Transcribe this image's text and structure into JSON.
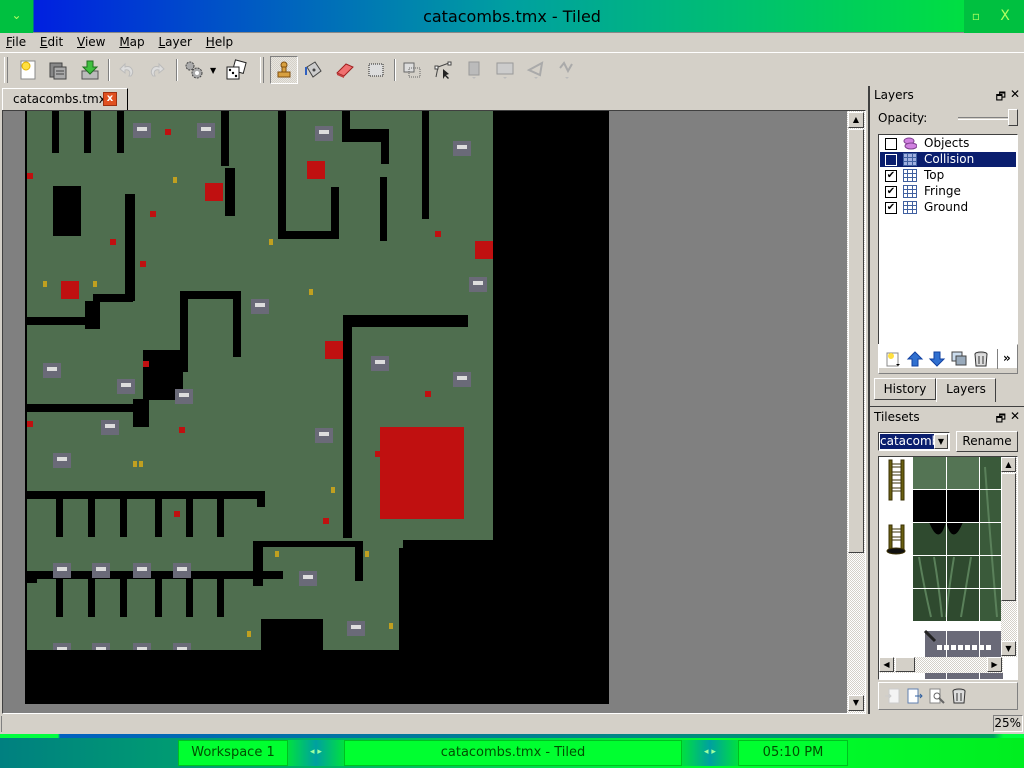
{
  "window": {
    "title": "catacombs.tmx - Tiled",
    "menu_icon": "⌄",
    "maximize_icon": "🗗",
    "close_icon": "X"
  },
  "menubar": {
    "items": [
      {
        "label": "File",
        "mnemonic": "F",
        "rest": "ile"
      },
      {
        "label": "Edit",
        "mnemonic": "E",
        "rest": "dit"
      },
      {
        "label": "View",
        "mnemonic": "V",
        "rest": "iew"
      },
      {
        "label": "Map",
        "mnemonic": "M",
        "rest": "ap"
      },
      {
        "label": "Layer",
        "mnemonic": "L",
        "rest": "ayer"
      },
      {
        "label": "Help",
        "mnemonic": "H",
        "rest": "elp"
      }
    ]
  },
  "toolbar": {
    "buttons": [
      {
        "name": "new-map",
        "icon": "new-document-icon",
        "enabled": true
      },
      {
        "name": "open",
        "icon": "open-folder-icon",
        "enabled": true
      },
      {
        "name": "save",
        "icon": "save-icon",
        "enabled": true
      },
      {
        "name": "undo",
        "icon": "undo-icon",
        "enabled": false
      },
      {
        "name": "redo",
        "icon": "redo-icon",
        "enabled": false
      },
      {
        "name": "commands",
        "icon": "gears-icon",
        "enabled": true
      },
      {
        "name": "random-mode",
        "icon": "dice-icon",
        "enabled": true
      },
      {
        "name": "stamp-brush",
        "icon": "stamp-icon",
        "enabled": true,
        "active": true
      },
      {
        "name": "bucket-fill",
        "icon": "bucket-icon",
        "enabled": true
      },
      {
        "name": "eraser",
        "icon": "eraser-icon",
        "enabled": true
      },
      {
        "name": "rect-select",
        "icon": "rect-select-icon",
        "enabled": true
      },
      {
        "name": "select-objects",
        "icon": "select-objects-icon",
        "enabled": true
      },
      {
        "name": "edit-polygons",
        "icon": "edit-polygons-icon",
        "enabled": true
      },
      {
        "name": "insert-rectangle",
        "icon": "insert-rectangle-icon",
        "enabled": false
      },
      {
        "name": "insert-image",
        "icon": "insert-image-icon",
        "enabled": false
      },
      {
        "name": "insert-polygon",
        "icon": "insert-polygon-icon",
        "enabled": false
      },
      {
        "name": "insert-polyline",
        "icon": "insert-polyline-icon",
        "enabled": false
      }
    ]
  },
  "tabs": [
    {
      "label": "catacombs.tmx",
      "close_icon": "x"
    }
  ],
  "layers_panel": {
    "title": "Layers",
    "opacity_label": "Opacity:",
    "opacity": 1.0,
    "layers": [
      {
        "name": "Objects",
        "type": "object",
        "visible": false,
        "selected": false
      },
      {
        "name": "Collision",
        "type": "tile",
        "visible": false,
        "selected": true
      },
      {
        "name": "Top",
        "type": "tile",
        "visible": true,
        "selected": false
      },
      {
        "name": "Fringe",
        "type": "tile",
        "visible": true,
        "selected": false
      },
      {
        "name": "Ground",
        "type": "tile",
        "visible": true,
        "selected": false
      }
    ],
    "more_icon": "»"
  },
  "dock_tabs": [
    {
      "label": "History",
      "active": false
    },
    {
      "label": "Layers",
      "active": true
    }
  ],
  "tilesets_panel": {
    "title": "Tilesets",
    "selected_tileset": "catacombs",
    "rename_label": "Rename"
  },
  "statusbar": {
    "zoom": "25%"
  },
  "taskbar": {
    "workspace": "Workspace 1",
    "task": "catacombs.tmx - Tiled",
    "clock": "05:10 PM",
    "arrows": "◂ ▸"
  },
  "colors": {
    "floor": "#4f6e4f",
    "wall": "#000000",
    "blood": "#c01010",
    "selection": "#0a1e6e",
    "canvas_bg": "#808080"
  }
}
